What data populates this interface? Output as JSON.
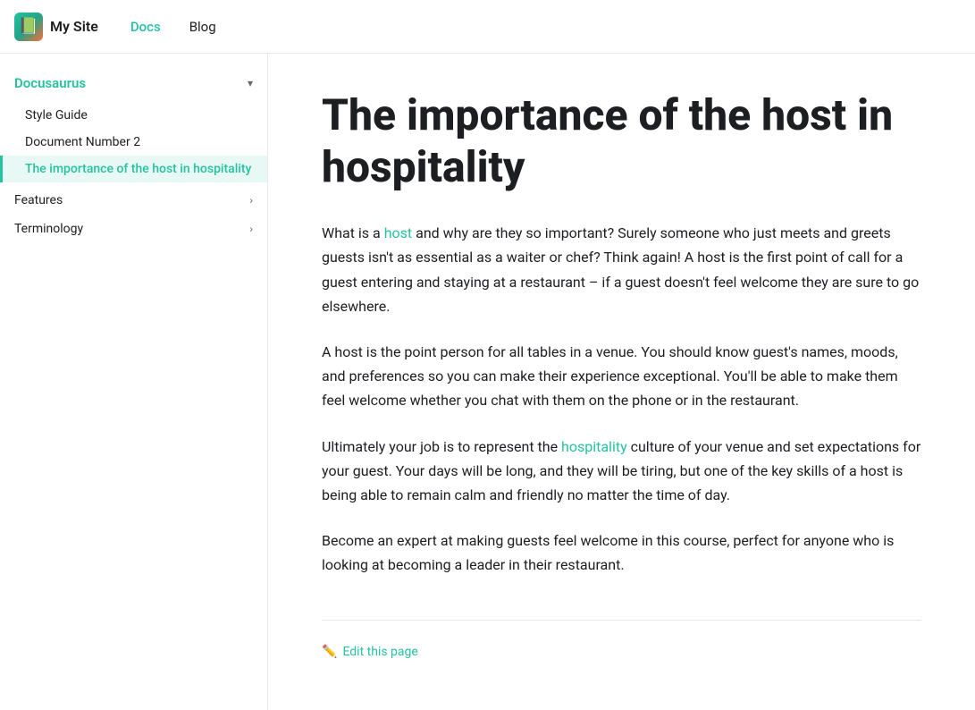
{
  "navbar": {
    "brand": "My Site",
    "logo_emoji": "📗",
    "links": [
      {
        "label": "Docs",
        "href": "#",
        "active": true
      },
      {
        "label": "Blog",
        "href": "#",
        "active": false
      }
    ]
  },
  "sidebar": {
    "section_title": "Docusaurus",
    "chevron": "▾",
    "items": [
      {
        "label": "Style Guide",
        "active": false
      },
      {
        "label": "Document Number 2",
        "active": false
      },
      {
        "label": "The importance of the host in hospitality",
        "active": true
      }
    ],
    "categories": [
      {
        "label": "Features",
        "chevron": "›"
      },
      {
        "label": "Terminology",
        "chevron": "›"
      }
    ]
  },
  "page": {
    "title": "The importance of the host in hospitality",
    "paragraphs": [
      {
        "id": "p1",
        "before_link": "What is a ",
        "link_text": "host",
        "after_link": " and why are they so important? Surely someone who just meets and greets guests isn't as essential as a waiter or chef? Think again! A host is the first point of call for a guest entering and staying at a restaurant – if a guest doesn't feel welcome they are sure to go elsewhere."
      },
      {
        "id": "p2",
        "text": "A host is the point person for all tables in a venue. You should know guest's names, moods, and preferences so you can make their experience exceptional. You'll be able to make them feel welcome whether you chat with them on the phone or in the restaurant."
      },
      {
        "id": "p3",
        "before_link": "Ultimately your job is to represent the ",
        "link_text": "hospitality",
        "after_link": " culture of your venue and set expectations for your guest. Your days will be long, and they will be tiring, but one of the key skills of a host is being able to remain calm and friendly no matter the time of day."
      },
      {
        "id": "p4",
        "text": "Become an expert at making guests feel welcome in this course, perfect for anyone who is looking at becoming a leader in their restaurant."
      }
    ],
    "edit_label": "Edit this page"
  }
}
